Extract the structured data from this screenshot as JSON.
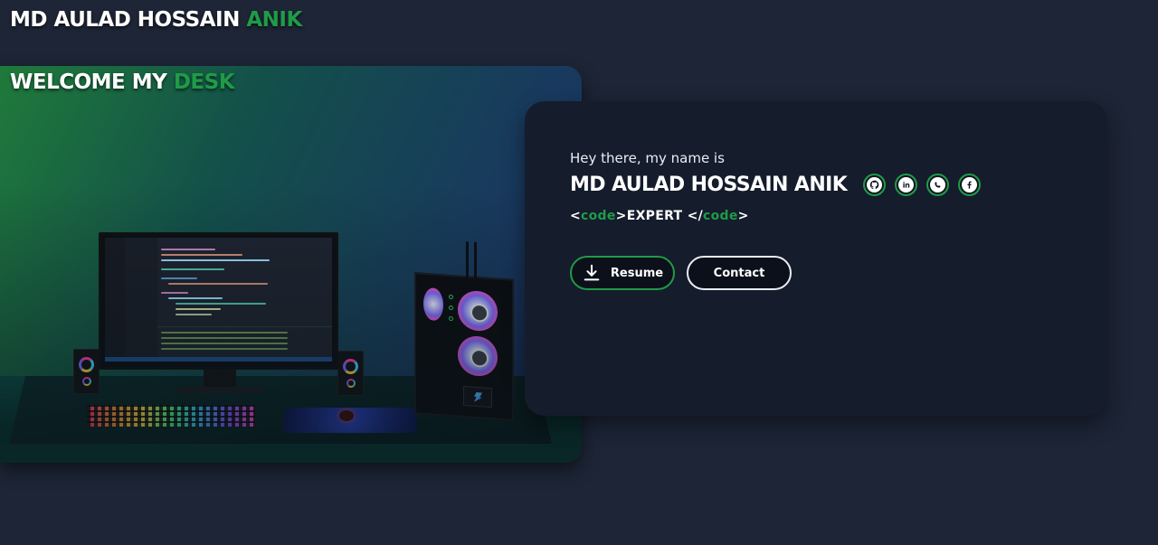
{
  "header": {
    "title_main": "MD AULAD HOSSAIN",
    "title_accent": "ANIK"
  },
  "scene": {
    "title_main": "WELCOME MY",
    "title_accent": "DESK"
  },
  "profile": {
    "greeting": "Hey there, my name is",
    "name": "MD AULAD HOSSAIN ANIK",
    "role": {
      "open_bracket": "<",
      "tag": "code",
      "close_bracket": ">",
      "text": "EXPERT",
      "end_open": " </",
      "end_tag": "code",
      "end_close": ">"
    },
    "social_icons": [
      "github-icon",
      "linkedin-icon",
      "whatsapp-icon",
      "facebook-icon"
    ],
    "buttons": {
      "resume_label": "Resume",
      "contact_label": "Contact"
    }
  },
  "colors": {
    "background": "#1d2536",
    "card": "#151c2c",
    "accent": "#1f9b48",
    "text": "#ffffff"
  }
}
